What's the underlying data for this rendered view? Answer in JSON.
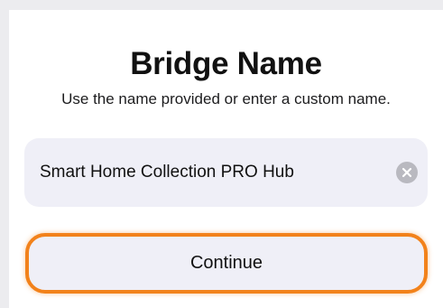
{
  "dialog": {
    "title": "Bridge Name",
    "subtitle": "Use the name provided or enter a custom name."
  },
  "name_field": {
    "value": "Smart Home Collection PRO Hub",
    "clear_icon": "clear-circle-x-icon"
  },
  "continue_button": {
    "label": "Continue",
    "highlight_color": "#f2821b"
  },
  "colors": {
    "field_background": "#efeff7",
    "window_background": "#ececef"
  }
}
